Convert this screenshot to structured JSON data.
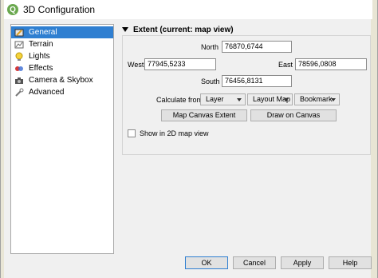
{
  "window": {
    "title": "3D Configuration",
    "app_icon_letter": "Q"
  },
  "sidebar": {
    "items": [
      {
        "label": "General",
        "icon": "general-icon"
      },
      {
        "label": "Terrain",
        "icon": "terrain-icon"
      },
      {
        "label": "Lights",
        "icon": "light-bulb-icon"
      },
      {
        "label": "Effects",
        "icon": "effects-icon"
      },
      {
        "label": "Camera & Skybox",
        "icon": "camera-icon"
      },
      {
        "label": "Advanced",
        "icon": "advanced-icon"
      }
    ],
    "selected": "General"
  },
  "extent": {
    "header": "Extent (current: map view)",
    "north_label": "North",
    "north_value": "76870,6744",
    "west_label": "West",
    "west_value": "77945,5233",
    "east_label": "East",
    "east_value": "78596,0808",
    "south_label": "South",
    "south_value": "76456,8131",
    "calc_from_label": "Calculate from",
    "layer_label": "Layer",
    "layout_map_label": "Layout Map",
    "bookmark_label": "Bookmark",
    "map_canvas_extent_label": "Map Canvas Extent",
    "draw_on_canvas_label": "Draw on Canvas",
    "show_2d_label": "Show in 2D map view",
    "show_2d_checked": false
  },
  "footer": {
    "ok": "OK",
    "cancel": "Cancel",
    "apply": "Apply",
    "help": "Help"
  },
  "colors": {
    "selection": "#2f7fd1",
    "app_icon": "#6aa84f"
  }
}
